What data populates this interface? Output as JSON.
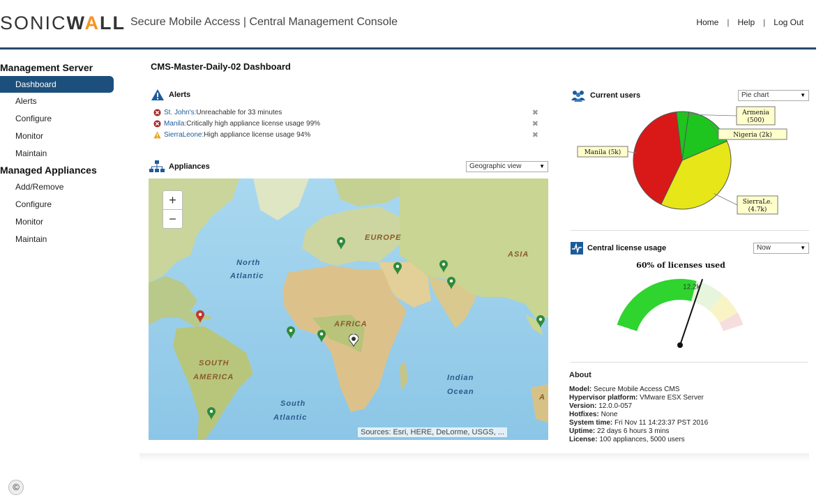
{
  "header": {
    "logo_part1": "SONIC",
    "logo_part2": "W",
    "logo_part3": "A",
    "logo_part4": "LL",
    "app_title": "Secure Mobile Access | Central Management Console",
    "nav": [
      "Home",
      "Help",
      "Log Out"
    ]
  },
  "sidebar": {
    "section1": "Management Server",
    "server_items": [
      "Dashboard",
      "Alerts",
      "Configure",
      "Monitor",
      "Maintain"
    ],
    "section2": "Managed Appliances",
    "appliance_items": [
      "Add/Remove",
      "Configure",
      "Monitor",
      "Maintain"
    ]
  },
  "dashboard_title": "CMS-Master-Daily-02 Dashboard",
  "alerts": {
    "title": "Alerts",
    "items": [
      {
        "site": "St. John's:",
        "msg": " Unreachable for 33 minutes",
        "severity": "critical"
      },
      {
        "site": "Manila:",
        "msg": " Critically high appliance license usage 99%",
        "severity": "critical"
      },
      {
        "site": "SierraLeone:",
        "msg": " High appliance license usage 94%",
        "severity": "warning"
      }
    ],
    "dismiss": "✖"
  },
  "appliances": {
    "title": "Appliances",
    "view_select": "Geographic view",
    "zoom_in": "+",
    "zoom_out": "−",
    "map_labels": [
      "EUROPE",
      "ASIA",
      "North",
      "Atlantic",
      "AFRICA",
      "SOUTH",
      "AMERICA",
      "Indian",
      "Ocean",
      "South",
      "Atlantic",
      "A"
    ],
    "attribution": "Sources: Esri, HERE, DeLorme, USGS, ..."
  },
  "current_users": {
    "title": "Current users",
    "chart_select": "Pie chart"
  },
  "chart_data": {
    "type": "pie",
    "slices": [
      {
        "label": "Armenia",
        "value_label": "(500)",
        "value": 500,
        "color": "#1ec51e"
      },
      {
        "label": "Nigeria (2k)",
        "value": 2000,
        "color": "#1ec51e"
      },
      {
        "label": "SierraLe.",
        "value_label": "(4.7k)",
        "value": 4700,
        "color": "#e6e619"
      },
      {
        "label": "Manila (5k)",
        "value": 5000,
        "color": "#d91818"
      }
    ]
  },
  "license": {
    "title": "Central license usage",
    "period_select": "Now",
    "gauge_title": "60% of licenses used",
    "gauge_value_label": "12.2k",
    "gauge_fraction": 0.6
  },
  "about": {
    "title": "About",
    "rows": [
      {
        "k": "Model:",
        "v": " Secure Mobile Access CMS"
      },
      {
        "k": "Hypervisor platform:",
        "v": " VMware ESX Server"
      },
      {
        "k": "Version:",
        "v": " 12.0.0-057"
      },
      {
        "k": "Hotfixes:",
        "v": " None"
      },
      {
        "k": "System time:",
        "v": " Fri Nov 11 14:23:37 PST 2016"
      },
      {
        "k": "Uptime:",
        "v": " 22 days 6 hours 3 mins"
      },
      {
        "k": "License:",
        "v": " 100 appliances, 5000 users"
      }
    ]
  },
  "copyright_symbol": "©",
  "colors": {
    "accent": "#1d4f7c",
    "header_rule": "#2a4a70",
    "ok_pin": "#2e8b3a",
    "alert_pin": "#c0392b"
  }
}
